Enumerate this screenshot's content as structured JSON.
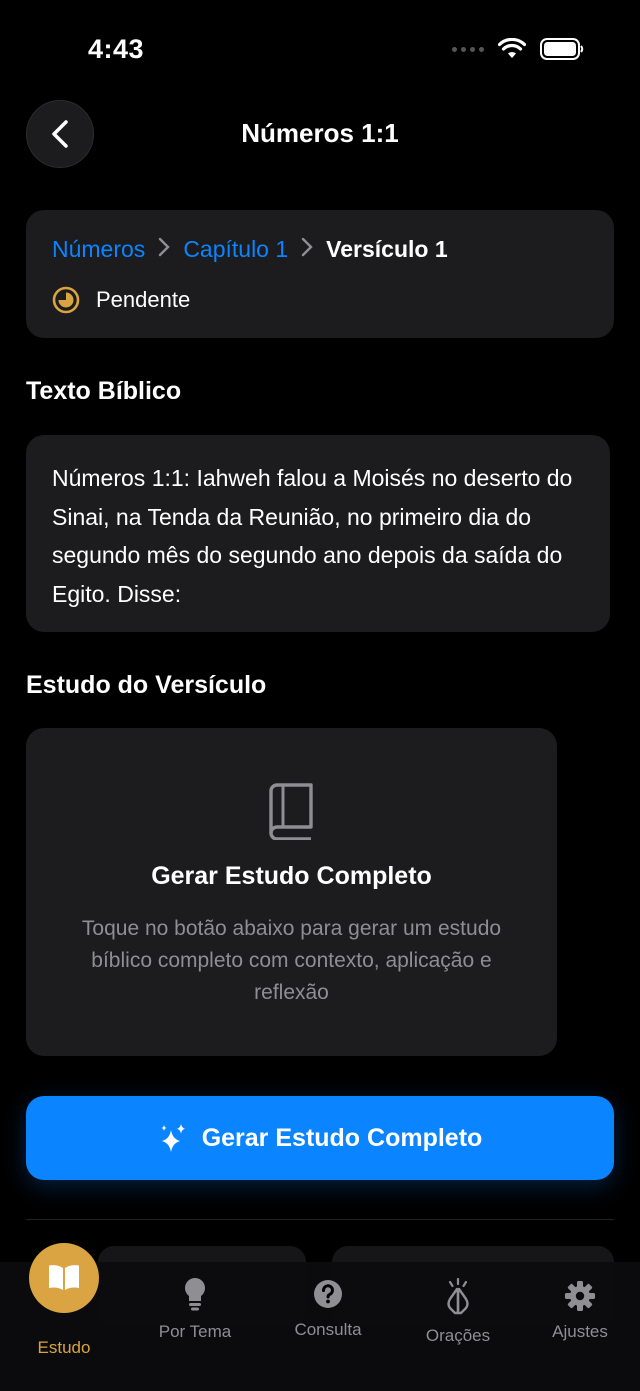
{
  "status_bar": {
    "time": "4:43"
  },
  "nav": {
    "title": "Números 1:1"
  },
  "breadcrumb": {
    "book": "Números",
    "chapter": "Capítulo 1",
    "verse": "Versículo 1",
    "status": "Pendente"
  },
  "bible_text": {
    "section_title": "Texto Bíblico",
    "text": "Números 1:1: Iahweh falou a Moisés no deserto do Sinai, na Tenda da Reunião, no primeiro dia do segundo mês do segundo ano depois da saída do Egito. Disse:"
  },
  "study": {
    "section_title": "Estudo do Versículo",
    "card_icon": "book-icon",
    "card_title": "Gerar Estudo Completo",
    "card_description": "Toque no botão abaixo para gerar um estudo bíblico completo com contexto, aplicação e reflexão",
    "button_label": "Gerar Estudo Completo",
    "button_icon": "sparkles-icon"
  },
  "tabs": [
    {
      "label": "Estudo",
      "icon": "open-book-icon",
      "active": true
    },
    {
      "label": "Por Tema",
      "icon": "lightbulb-icon",
      "active": false
    },
    {
      "label": "Consulta",
      "icon": "question-circle-icon",
      "active": false
    },
    {
      "label": "Orações",
      "icon": "praying-hands-icon",
      "active": false
    },
    {
      "label": "Ajustes",
      "icon": "gear-icon",
      "active": false
    }
  ],
  "colors": {
    "accent_blue": "#0a84ff",
    "accent_gold": "#d9a441",
    "card_bg": "#1c1c1e",
    "secondary_text": "#8e8e93"
  }
}
